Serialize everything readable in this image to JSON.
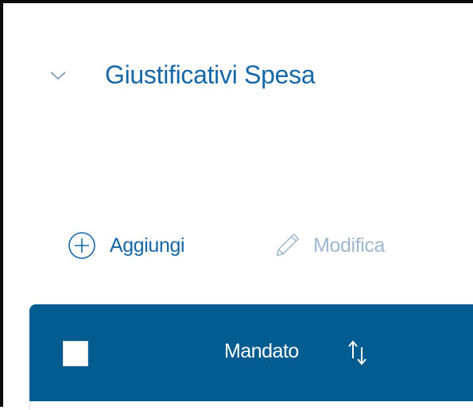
{
  "section": {
    "title": "Giustificativi Spesa",
    "chevron_icon": "chevron-down-icon"
  },
  "toolbar": {
    "add_label": "Aggiungi",
    "add_icon": "plus-circle-icon",
    "edit_label": "Modifica",
    "edit_icon": "pencil-icon"
  },
  "table": {
    "columns": [
      {
        "label": "Mandato",
        "sort_icon": "sort-arrows-icon"
      }
    ]
  },
  "colors": {
    "accent": "#1667a8",
    "header_bg": "#035c8f",
    "disabled": "#9fb7cf"
  }
}
